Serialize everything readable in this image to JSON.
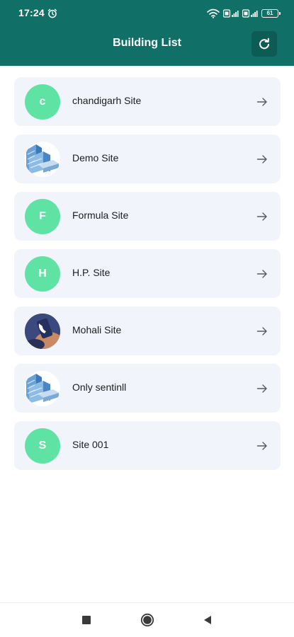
{
  "status_bar": {
    "time": "17:24",
    "battery": "61"
  },
  "app_bar": {
    "title": "Building List"
  },
  "sites": [
    {
      "name": "chandigarh Site",
      "avatar_type": "letter",
      "avatar_letter": "c"
    },
    {
      "name": "Demo Site",
      "avatar_type": "building-image"
    },
    {
      "name": "Formula Site",
      "avatar_type": "letter",
      "avatar_letter": "F"
    },
    {
      "name": "H.P. Site",
      "avatar_type": "letter",
      "avatar_letter": "H"
    },
    {
      "name": "Mohali Site",
      "avatar_type": "photo-image"
    },
    {
      "name": "Only sentinll",
      "avatar_type": "building-image"
    },
    {
      "name": "Site 001",
      "avatar_type": "letter",
      "avatar_letter": "S"
    }
  ],
  "icons": {
    "refresh": "refresh-icon",
    "item_action": "arrow-right-icon",
    "nav_recent": "square-icon",
    "nav_home": "circle-icon",
    "nav_back": "triangle-back-icon"
  },
  "colors": {
    "primary": "#106f67",
    "avatar_green": "#5ee3a4",
    "card_background": "#f1f4fb"
  }
}
